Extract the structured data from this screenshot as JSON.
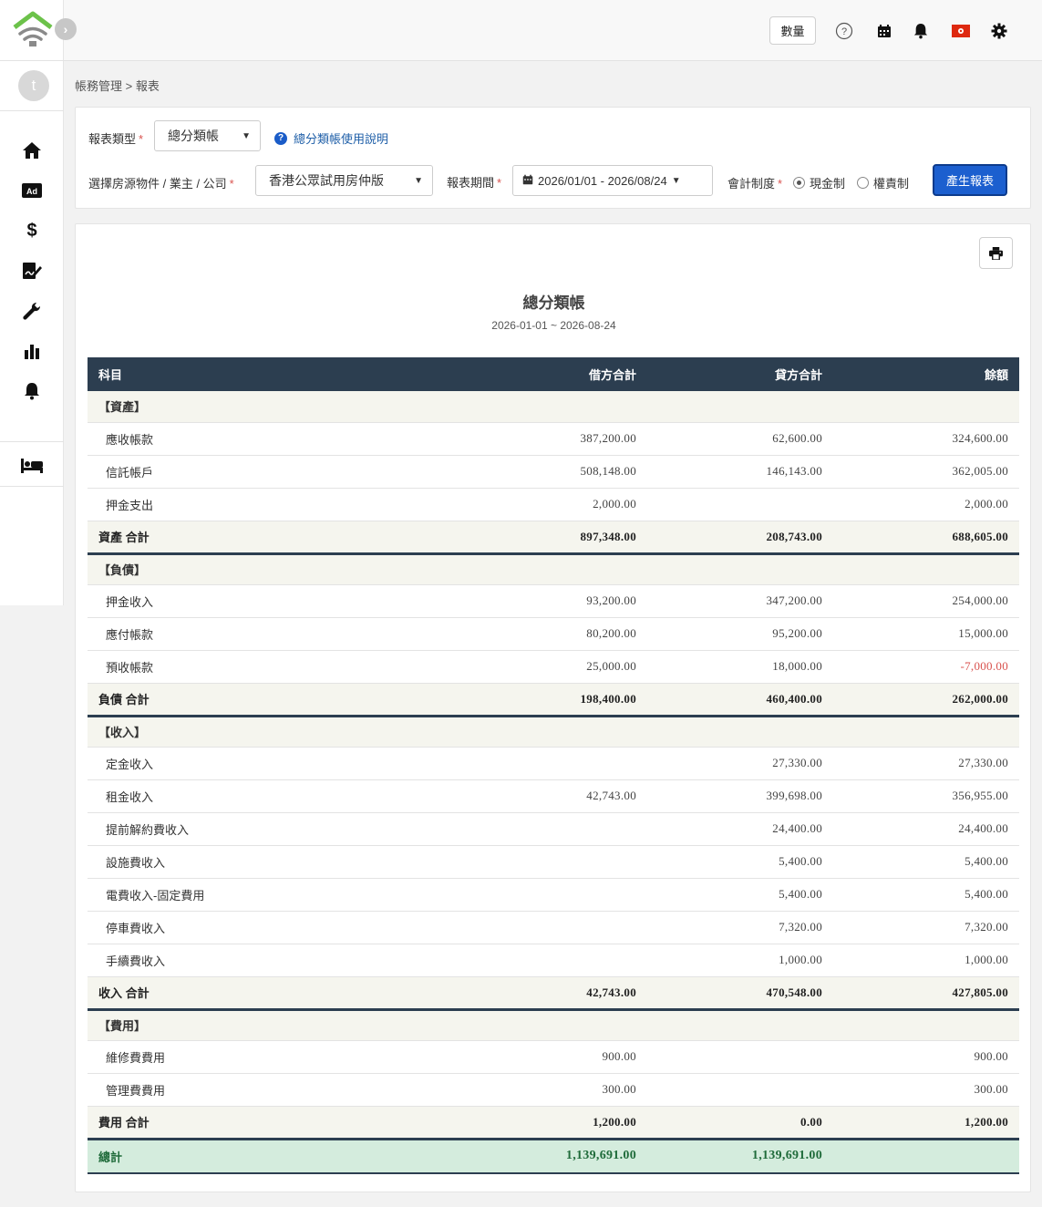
{
  "topbar": {
    "quantity_label": "數量"
  },
  "sidebar": {
    "avatar_initial": "t",
    "items": [
      {
        "icon": "home-icon"
      },
      {
        "icon": "ad-icon",
        "text": "Ad"
      },
      {
        "icon": "dollar-icon"
      },
      {
        "icon": "signature-icon"
      },
      {
        "icon": "wrench-icon"
      },
      {
        "icon": "bar-chart-icon"
      },
      {
        "icon": "bell-icon"
      },
      {
        "icon": "bed-icon"
      }
    ]
  },
  "breadcrumb": "帳務管理 > 報表",
  "filters": {
    "report_type_label": "報表類型",
    "report_type_value": "總分類帳",
    "help_link": "總分類帳使用說明",
    "property_label": "選擇房源物件 / 業主 / 公司",
    "property_value": "香港公眾試用房仲版",
    "period_label": "報表期間",
    "period_value": "2026/01/01 - 2026/08/24",
    "accounting_label": "會計制度",
    "accounting_options": [
      "現金制",
      "權責制"
    ],
    "accounting_selected": "現金制",
    "generate_button": "產生報表"
  },
  "report": {
    "title": "總分類帳",
    "date_range": "2026-01-01 ~ 2026-08-24",
    "columns": [
      "科目",
      "借方合計",
      "貸方合計",
      "餘額"
    ],
    "sections": [
      {
        "name": "【資產】",
        "rows": [
          {
            "name": "應收帳款",
            "debit": "387,200.00",
            "credit": "62,600.00",
            "balance": "324,600.00"
          },
          {
            "name": "信託帳戶",
            "debit": "508,148.00",
            "credit": "146,143.00",
            "balance": "362,005.00"
          },
          {
            "name": "押金支出",
            "debit": "2,000.00",
            "credit": "",
            "balance": "2,000.00"
          }
        ],
        "total": {
          "name": "資產 合計",
          "debit": "897,348.00",
          "credit": "208,743.00",
          "balance": "688,605.00"
        }
      },
      {
        "name": "【負債】",
        "rows": [
          {
            "name": "押金收入",
            "debit": "93,200.00",
            "credit": "347,200.00",
            "balance": "254,000.00"
          },
          {
            "name": "應付帳款",
            "debit": "80,200.00",
            "credit": "95,200.00",
            "balance": "15,000.00"
          },
          {
            "name": "預收帳款",
            "debit": "25,000.00",
            "credit": "18,000.00",
            "balance": "-7,000.00"
          }
        ],
        "total": {
          "name": "負債 合計",
          "debit": "198,400.00",
          "credit": "460,400.00",
          "balance": "262,000.00"
        }
      },
      {
        "name": "【收入】",
        "rows": [
          {
            "name": "定金收入",
            "debit": "",
            "credit": "27,330.00",
            "balance": "27,330.00"
          },
          {
            "name": "租金收入",
            "debit": "42,743.00",
            "credit": "399,698.00",
            "balance": "356,955.00"
          },
          {
            "name": "提前解約費收入",
            "debit": "",
            "credit": "24,400.00",
            "balance": "24,400.00"
          },
          {
            "name": "設施費收入",
            "debit": "",
            "credit": "5,400.00",
            "balance": "5,400.00"
          },
          {
            "name": "電費收入-固定費用",
            "debit": "",
            "credit": "5,400.00",
            "balance": "5,400.00"
          },
          {
            "name": "停車費收入",
            "debit": "",
            "credit": "7,320.00",
            "balance": "7,320.00"
          },
          {
            "name": "手續費收入",
            "debit": "",
            "credit": "1,000.00",
            "balance": "1,000.00"
          }
        ],
        "total": {
          "name": "收入 合計",
          "debit": "42,743.00",
          "credit": "470,548.00",
          "balance": "427,805.00"
        }
      },
      {
        "name": "【費用】",
        "rows": [
          {
            "name": "維修費費用",
            "debit": "900.00",
            "credit": "",
            "balance": "900.00"
          },
          {
            "name": "管理費費用",
            "debit": "300.00",
            "credit": "",
            "balance": "300.00"
          }
        ],
        "total": {
          "name": "費用 合計",
          "debit": "1,200.00",
          "credit": "0.00",
          "balance": "1,200.00"
        }
      }
    ],
    "grand_total": {
      "name": "總計",
      "debit": "1,139,691.00",
      "credit": "1,139,691.00",
      "balance": ""
    }
  },
  "colors": {
    "header_bg": "#2c3e50",
    "primary_button": "#1c5fcf",
    "negative": "#d9534f",
    "grand_total_bg": "#d4ecdd",
    "logo_green": "#6cc24a"
  }
}
